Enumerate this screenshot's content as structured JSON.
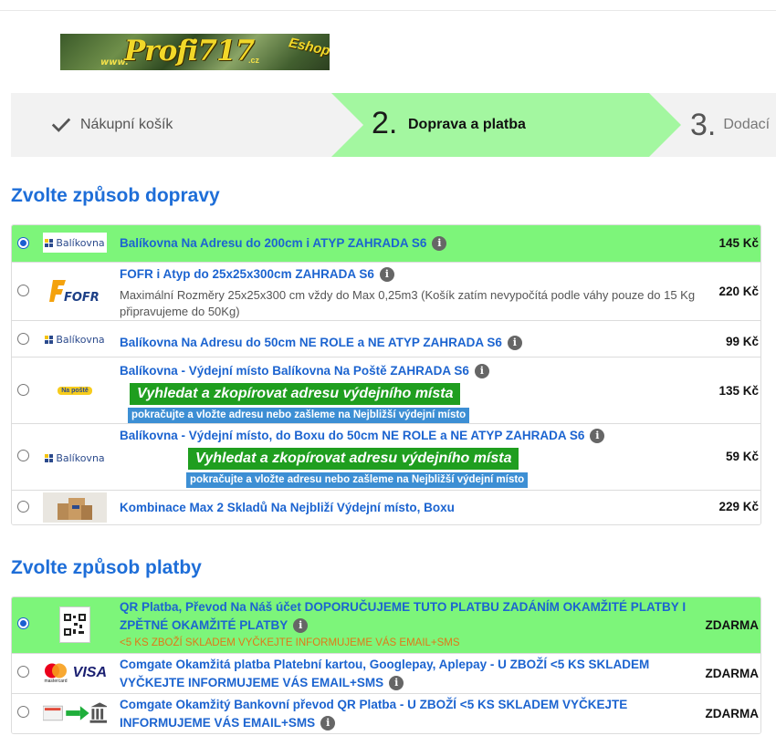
{
  "logo": {
    "www": "www.",
    "brand": "Profi717",
    "tld": ".cz",
    "eshop": "Eshop"
  },
  "steps": [
    {
      "label": "Nákupní košík"
    },
    {
      "number": "2.",
      "label": "Doprava a platba"
    },
    {
      "number": "3.",
      "label": "Dodací"
    }
  ],
  "shipping": {
    "title": "Zvolte způsob dopravy",
    "options": [
      {
        "name": "Balíkovna Na Adresu do 200cm i ATYP ZAHRADA S6",
        "price": "145 Kč",
        "selected": true,
        "icon": "balikovna-logo",
        "icon_text": "Balíkovna"
      },
      {
        "name": "FOFR i Atyp do 25x25x300cm ZAHRADA S6",
        "description": "Maximální Rozměry 25x25x300 cm vždy do Max 0,25m3 (Košík zatím nevypočítá podle váhy pouze do 15 Kg připravujeme do 50Kg)",
        "price": "220 Kč",
        "icon": "fofr-logo",
        "icon_text": "FOFR"
      },
      {
        "name": "Balíkovna Na Adresu do 50cm NE ROLE a NE ATYP ZAHRADA S6",
        "price": "99 Kč",
        "icon": "balikovna-logo",
        "icon_text": "Balíkovna"
      },
      {
        "name": "Balíkovna - Výdejní místo Balíkovna Na Poště ZAHRADA S6",
        "button": "Vyhledat a zkopírovat adresu výdejního místa",
        "hint": "pokračujte a vložte adresu nebo zašleme na Nejbližší výdejní místo",
        "price": "135 Kč",
        "icon": "na-poste-logo",
        "icon_text": "Na poště"
      },
      {
        "name": "Balíkovna - Výdejní místo, do Boxu do 50cm  NE ROLE a NE ATYP ZAHRADA S6",
        "button": "Vyhledat a zkopírovat adresu výdejního místa",
        "hint": "pokračujte a vložte adresu nebo zašleme na Nejbližší výdejní místo",
        "price": "59 Kč",
        "icon": "balikovna-logo",
        "icon_text": "Balíkovna"
      },
      {
        "name": "Kombinace Max 2 Skladů Na Nejbliží Výdejní místo, Boxu",
        "price": "229 Kč",
        "icon": "parcels-photo"
      }
    ]
  },
  "payment": {
    "title": "Zvolte způsob platby",
    "options": [
      {
        "name": "QR Platba, Převod Na Náš účet DOPORUČUJEME TUTO PLATBU ZADÁNÍM OKAMŽITÉ PLATBY I ZPĚTNÉ OKAMŽITÉ PLATBY",
        "warning": "<5 KS ZBOŽÍ SKLADEM VYČKEJTE INFORMUJEME VÁS EMAIL+SMS",
        "price": "ZDARMA",
        "selected": true,
        "icon": "qr-code-icon"
      },
      {
        "name": "Comgate Okamžitá platba Platební kartou, Googlepay, Aplepay - U ZBOŽÍ <5 KS SKLADEM VYČKEJTE INFORMUJEME VÁS EMAIL+SMS",
        "price": "ZDARMA",
        "icon": "card-logos",
        "icon_text_1": "mastercard",
        "icon_text_2": "VISA"
      },
      {
        "name": "Comgate Okamžitý Bankovní převod QR Platba - U ZBOŽÍ <5 KS SKLADEM VYČKEJTE INFORMUJEME VÁS EMAIL+SMS",
        "price": "ZDARMA",
        "icon": "bank-transfer-icon"
      }
    ]
  },
  "colors": {
    "accent": "#1e6ed8",
    "selected_row": "#7df57a",
    "step_active": "#a3f7a0",
    "button_green": "#1f9e1f",
    "hint_blue": "#3d8fd4",
    "warning": "#e07818"
  }
}
